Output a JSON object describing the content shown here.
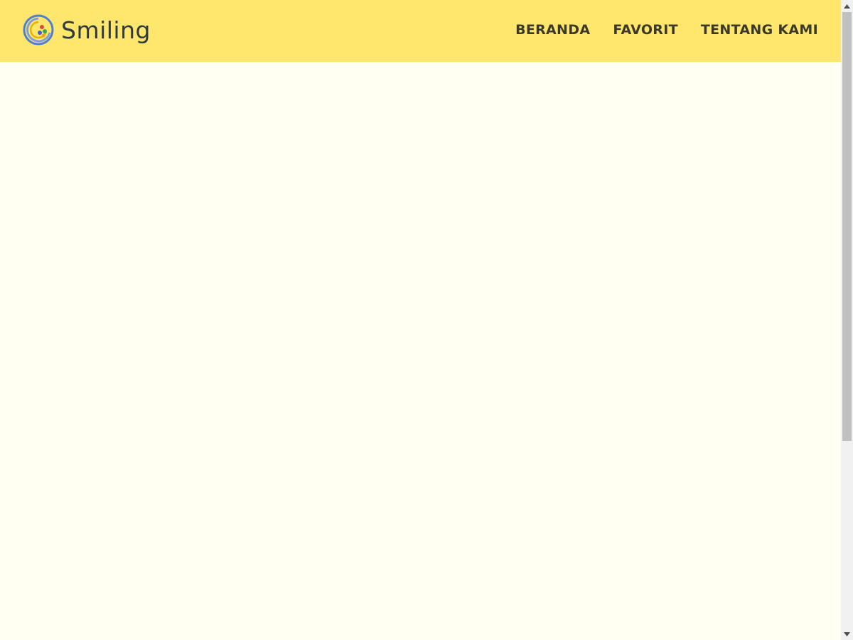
{
  "brand": {
    "name": "Smiling",
    "logo_icon": "smiling-logo-icon"
  },
  "nav": {
    "items": [
      {
        "label": "BERANDA"
      },
      {
        "label": "FAVORIT"
      },
      {
        "label": "TENTANG KAMI"
      }
    ]
  },
  "colors": {
    "navbar_bg": "#ffe66d",
    "page_bg": "#fffff2",
    "nav_text": "#3b3a2a",
    "brand_text": "#2f3a40"
  },
  "scrollbar": {
    "up_icon": "scroll-up-arrow-icon",
    "down_icon": "scroll-down-arrow-icon"
  }
}
